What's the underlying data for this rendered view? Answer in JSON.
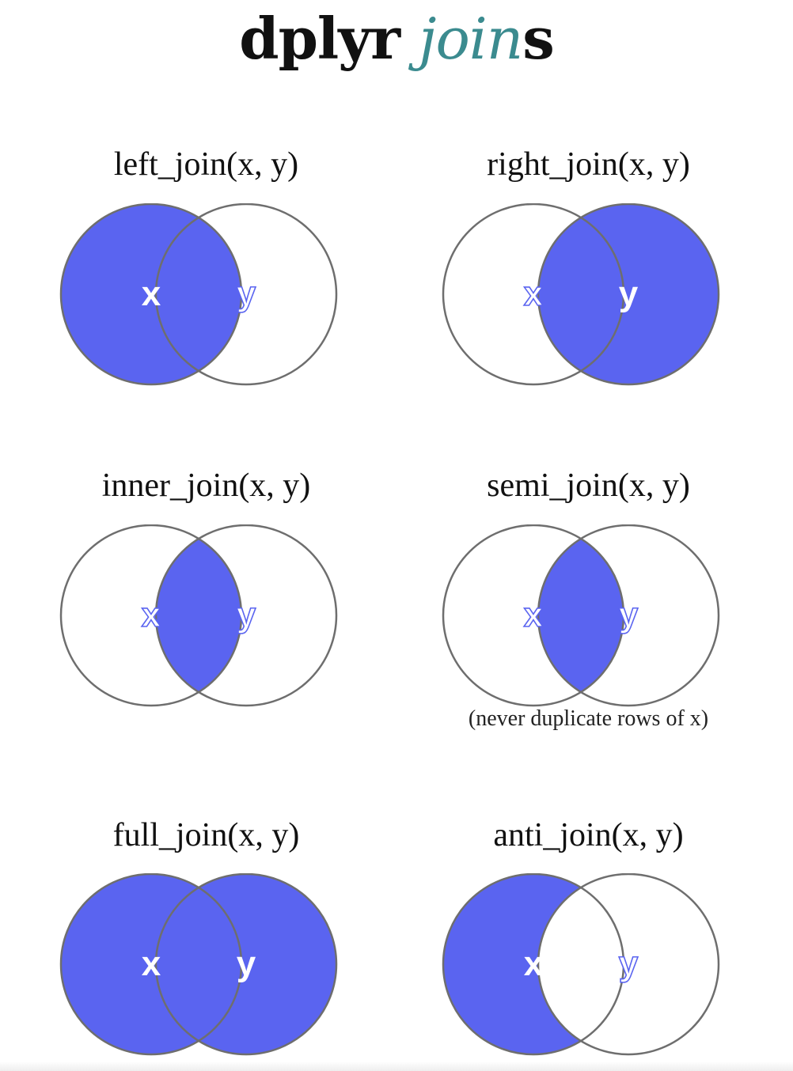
{
  "title": {
    "plain": "dplyr",
    "accent": "join",
    "tail": "s",
    "accent_color": "#3b8b8f"
  },
  "colors": {
    "fill": "#5a64f0",
    "stroke": "#6e6e6e",
    "background": "#ffffff"
  },
  "venn_labels": {
    "x": "x",
    "y": "y"
  },
  "panels": [
    {
      "caption": "left_join(x, y)",
      "shaded": "x_all",
      "label_style": {
        "x": "solid",
        "y": "outline"
      }
    },
    {
      "caption": "right_join(x, y)",
      "shaded": "y_all",
      "label_style": {
        "x": "outline",
        "y": "solid"
      }
    },
    {
      "caption": "inner_join(x, y)",
      "shaded": "intersection",
      "label_style": {
        "x": "outline",
        "y": "outline"
      }
    },
    {
      "caption": "semi_join(x, y)",
      "shaded": "intersection",
      "label_style": {
        "x": "outline",
        "y": "outline"
      },
      "note": "(never duplicate rows of x)"
    },
    {
      "caption": "full_join(x, y)",
      "shaded": "union",
      "label_style": {
        "x": "solid",
        "y": "solid"
      }
    },
    {
      "caption": "anti_join(x, y)",
      "shaded": "x_only",
      "label_style": {
        "x": "solid",
        "y": "outline"
      }
    }
  ]
}
